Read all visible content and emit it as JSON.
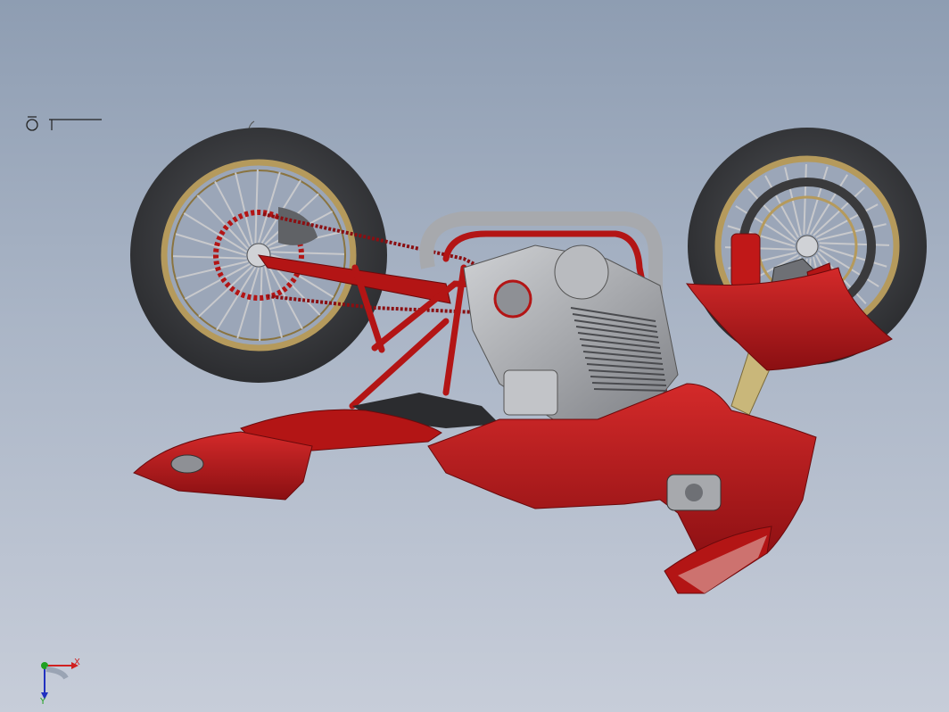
{
  "viewport": {
    "model": "motorcycle-assembly",
    "background_top": "#8e9db2",
    "background_bottom": "#c7cdd9"
  },
  "colors": {
    "body_red": "#c01818",
    "body_red_dark": "#8a0f12",
    "frame_red": "#b31515",
    "tire": "#3a3a3c",
    "rim_gold": "#b59a5c",
    "metal_gray": "#a7a9ad",
    "metal_dark": "#6e7075",
    "fork_gold": "#c9b77a"
  },
  "triad": {
    "x_label": "X",
    "y_label": "Y",
    "x_color": "#d02020",
    "y_color": "#20a020",
    "z_color": "#2030c0"
  },
  "indicator_icon": "view-orientation-icon"
}
